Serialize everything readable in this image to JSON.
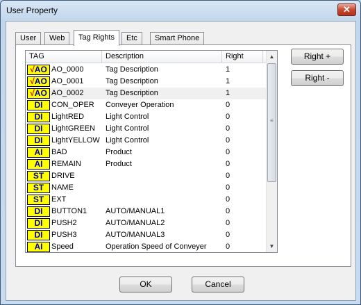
{
  "window": {
    "title": "User Property",
    "close_glyph": "✕"
  },
  "tabs": [
    {
      "label": "User"
    },
    {
      "label": "Web"
    },
    {
      "label": "Tag Rights",
      "active": true
    },
    {
      "label": "Etc"
    },
    {
      "label": "Smart Phone"
    }
  ],
  "table": {
    "columns": [
      "TAG",
      "Description",
      "Right"
    ],
    "rows": [
      {
        "badge": "AO",
        "check": true,
        "tag": "AO_0000",
        "desc": "Tag Description",
        "right": "1"
      },
      {
        "badge": "AO",
        "check": true,
        "tag": "AO_0001",
        "desc": "Tag Description",
        "right": "1"
      },
      {
        "badge": "AO",
        "check": true,
        "tag": "AO_0002",
        "desc": "Tag Description",
        "right": "1"
      },
      {
        "badge": "DI",
        "check": false,
        "tag": "CON_OPER",
        "desc": "Conveyer Operation",
        "right": "0"
      },
      {
        "badge": "DI",
        "check": false,
        "tag": "LightRED",
        "desc": "Light Control",
        "right": "0"
      },
      {
        "badge": "DI",
        "check": false,
        "tag": "LightGREEN",
        "desc": "Light Control",
        "right": "0"
      },
      {
        "badge": "DI",
        "check": false,
        "tag": "LightYELLOW",
        "desc": "Light Control",
        "right": "0"
      },
      {
        "badge": "AI",
        "check": false,
        "tag": "BAD",
        "desc": "Product",
        "right": "0"
      },
      {
        "badge": "AI",
        "check": false,
        "tag": "REMAIN",
        "desc": "Product",
        "right": "0"
      },
      {
        "badge": "ST",
        "check": false,
        "tag": "DRIVE",
        "desc": "",
        "right": "0"
      },
      {
        "badge": "ST",
        "check": false,
        "tag": "NAME",
        "desc": "",
        "right": "0"
      },
      {
        "badge": "ST",
        "check": false,
        "tag": "EXT",
        "desc": "",
        "right": "0"
      },
      {
        "badge": "DI",
        "check": false,
        "tag": "BUTTON1",
        "desc": "AUTO/MANUAL1",
        "right": "0"
      },
      {
        "badge": "DI",
        "check": false,
        "tag": "PUSH2",
        "desc": "AUTO/MANUAL2",
        "right": "0"
      },
      {
        "badge": "DI",
        "check": false,
        "tag": "PUSH3",
        "desc": "AUTO/MANUAL3",
        "right": "0"
      },
      {
        "badge": "AI",
        "check": false,
        "tag": "Speed",
        "desc": "Operation Speed of Conveyer",
        "right": "0"
      }
    ]
  },
  "side_buttons": {
    "right_plus": "Right +",
    "right_minus": "Right -"
  },
  "footer": {
    "ok": "OK",
    "cancel": "Cancel"
  },
  "scroll": {
    "up_glyph": "▲",
    "down_glyph": "▼",
    "grip_glyph": "≡"
  },
  "check_glyph": "√"
}
